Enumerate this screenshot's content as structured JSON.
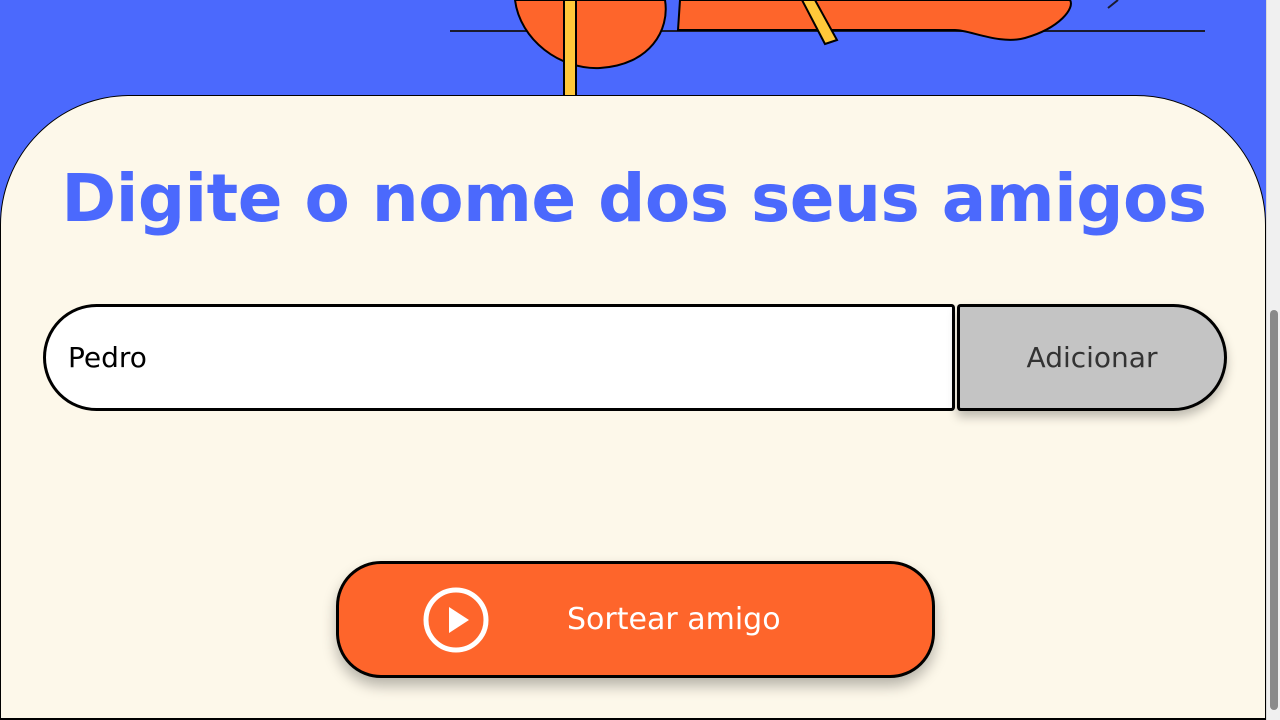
{
  "page": {
    "heading": "Digite o nome dos seus amigos"
  },
  "form": {
    "name_value": "Pedro",
    "add_label": "Adicionar"
  },
  "draw": {
    "label": "Sortear amigo",
    "icon": "play-circle-icon"
  },
  "colors": {
    "background_blue": "#4B69FD",
    "card_cream": "#FDF8EA",
    "accent_orange": "#FE652B",
    "button_gray": "#C4C4C4",
    "stick_yellow": "#FFC83A"
  }
}
